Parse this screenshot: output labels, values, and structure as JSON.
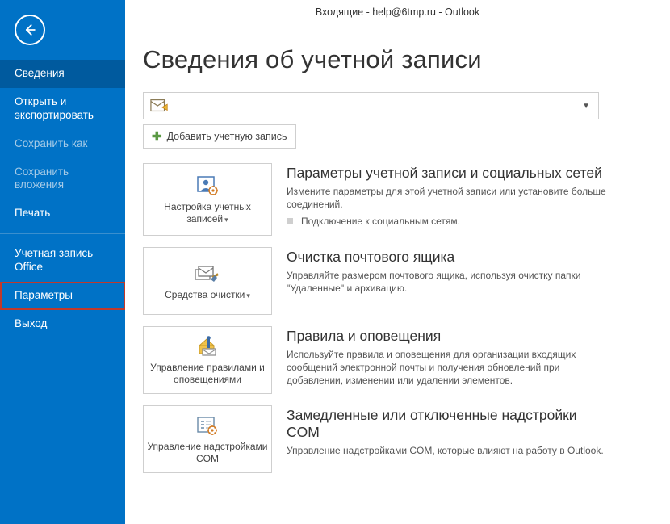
{
  "window": {
    "title": "Входящие - help@6tmp.ru - Outlook"
  },
  "sidebar": {
    "items": [
      {
        "label": "Сведения",
        "active": true
      },
      {
        "label": "Открыть и экспортировать"
      },
      {
        "label": "Сохранить как",
        "dim": true
      },
      {
        "label": "Сохранить вложения",
        "dim": true
      },
      {
        "label": "Печать"
      }
    ],
    "items2": [
      {
        "label": "Учетная запись Office"
      },
      {
        "label": "Параметры",
        "highlight": true
      },
      {
        "label": "Выход"
      }
    ]
  },
  "main": {
    "heading": "Сведения об учетной записи",
    "add_account": "Добавить учетную запись",
    "sections": [
      {
        "tile": "Настройка учетных записей",
        "title": "Параметры учетной записи и социальных сетей",
        "text": "Измените параметры для этой учетной записи или установите больше соединений.",
        "bullet": "Подключение к социальным сетям.",
        "has_caret": true
      },
      {
        "tile": "Средства очистки",
        "title": "Очистка почтового ящика",
        "text": "Управляйте размером почтового ящика, используя очистку папки \"Удаленные\" и архивацию.",
        "has_caret": true
      },
      {
        "tile": "Управление правилами и оповещениями",
        "title": "Правила и оповещения",
        "text": "Используйте правила и оповещения для организации входящих сообщений электронной почты и получения обновлений при добавлении, изменении или удалении элементов."
      },
      {
        "tile": "Управление надстройками COM",
        "title": "Замедленные или отключенные надстройки COM",
        "text": "Управление надстройками COM, которые влияют на работу в Outlook."
      }
    ]
  }
}
